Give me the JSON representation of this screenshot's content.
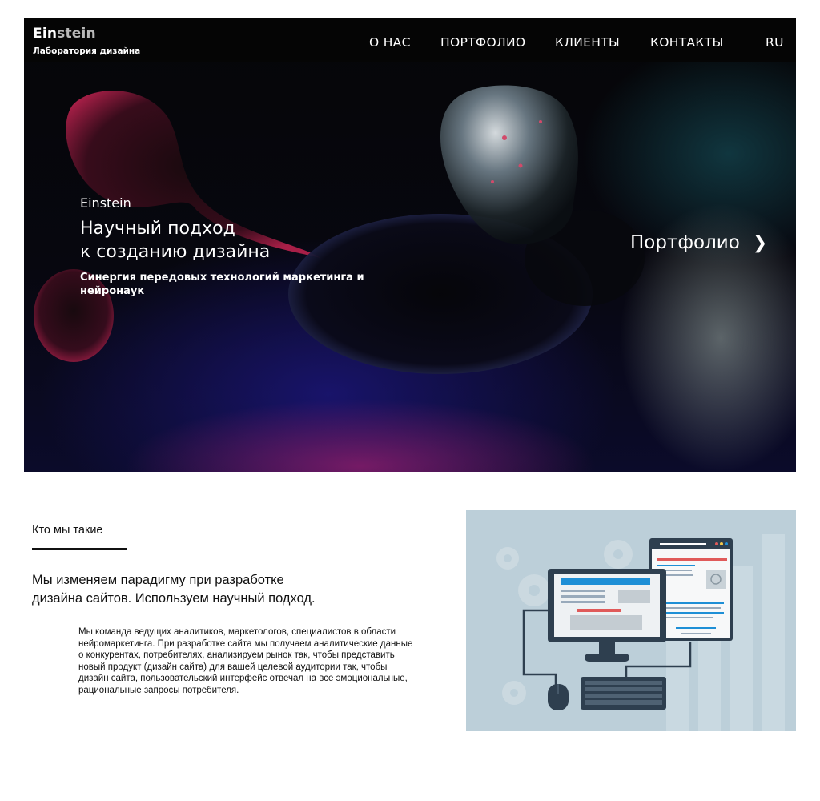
{
  "brand": {
    "name_part1": "Ein",
    "name_part2": "stein",
    "subtitle": "Лаборатория дизайна"
  },
  "nav": {
    "items": [
      {
        "label": "О НАС"
      },
      {
        "label": "ПОРТФОЛИО"
      },
      {
        "label": "КЛИЕНТЫ"
      },
      {
        "label": "КОНТАКТЫ"
      }
    ],
    "language": "RU"
  },
  "hero": {
    "kicker": "Einstein",
    "title_line1": "Научный подход",
    "title_line2": "к созданию дизайна",
    "subtitle": "Синергия передовых технологий маркетинга и нейронаук",
    "cta_label": "Портфолио",
    "cta_icon": "chevron-right-icon"
  },
  "about": {
    "heading": "Кто мы такие",
    "lead_line1": "Мы изменяем парадигму при разработке",
    "lead_line2": "дизайна сайтов. Используем научный подход.",
    "body": "Мы команда ведущих аналитиков, маркетологов, специалистов в области нейромаркетинга. При разработке сайта мы получаем аналитические данные о конкурентах, потребителях, анализируем рынок так, чтобы представить новый продукт (дизайн сайта) для вашей целевой аудитории так, чтобы дизайн сайта, пользовательский интерфейс отвечал на все эмоциональные, рациональные запросы потребителя."
  },
  "colors": {
    "navbar": "#050505",
    "illustration_bg": "#bccfd9",
    "monitor_dark": "#2e3f4f",
    "accent_blue": "#1e8fd6",
    "accent_red": "#e05a5a"
  }
}
